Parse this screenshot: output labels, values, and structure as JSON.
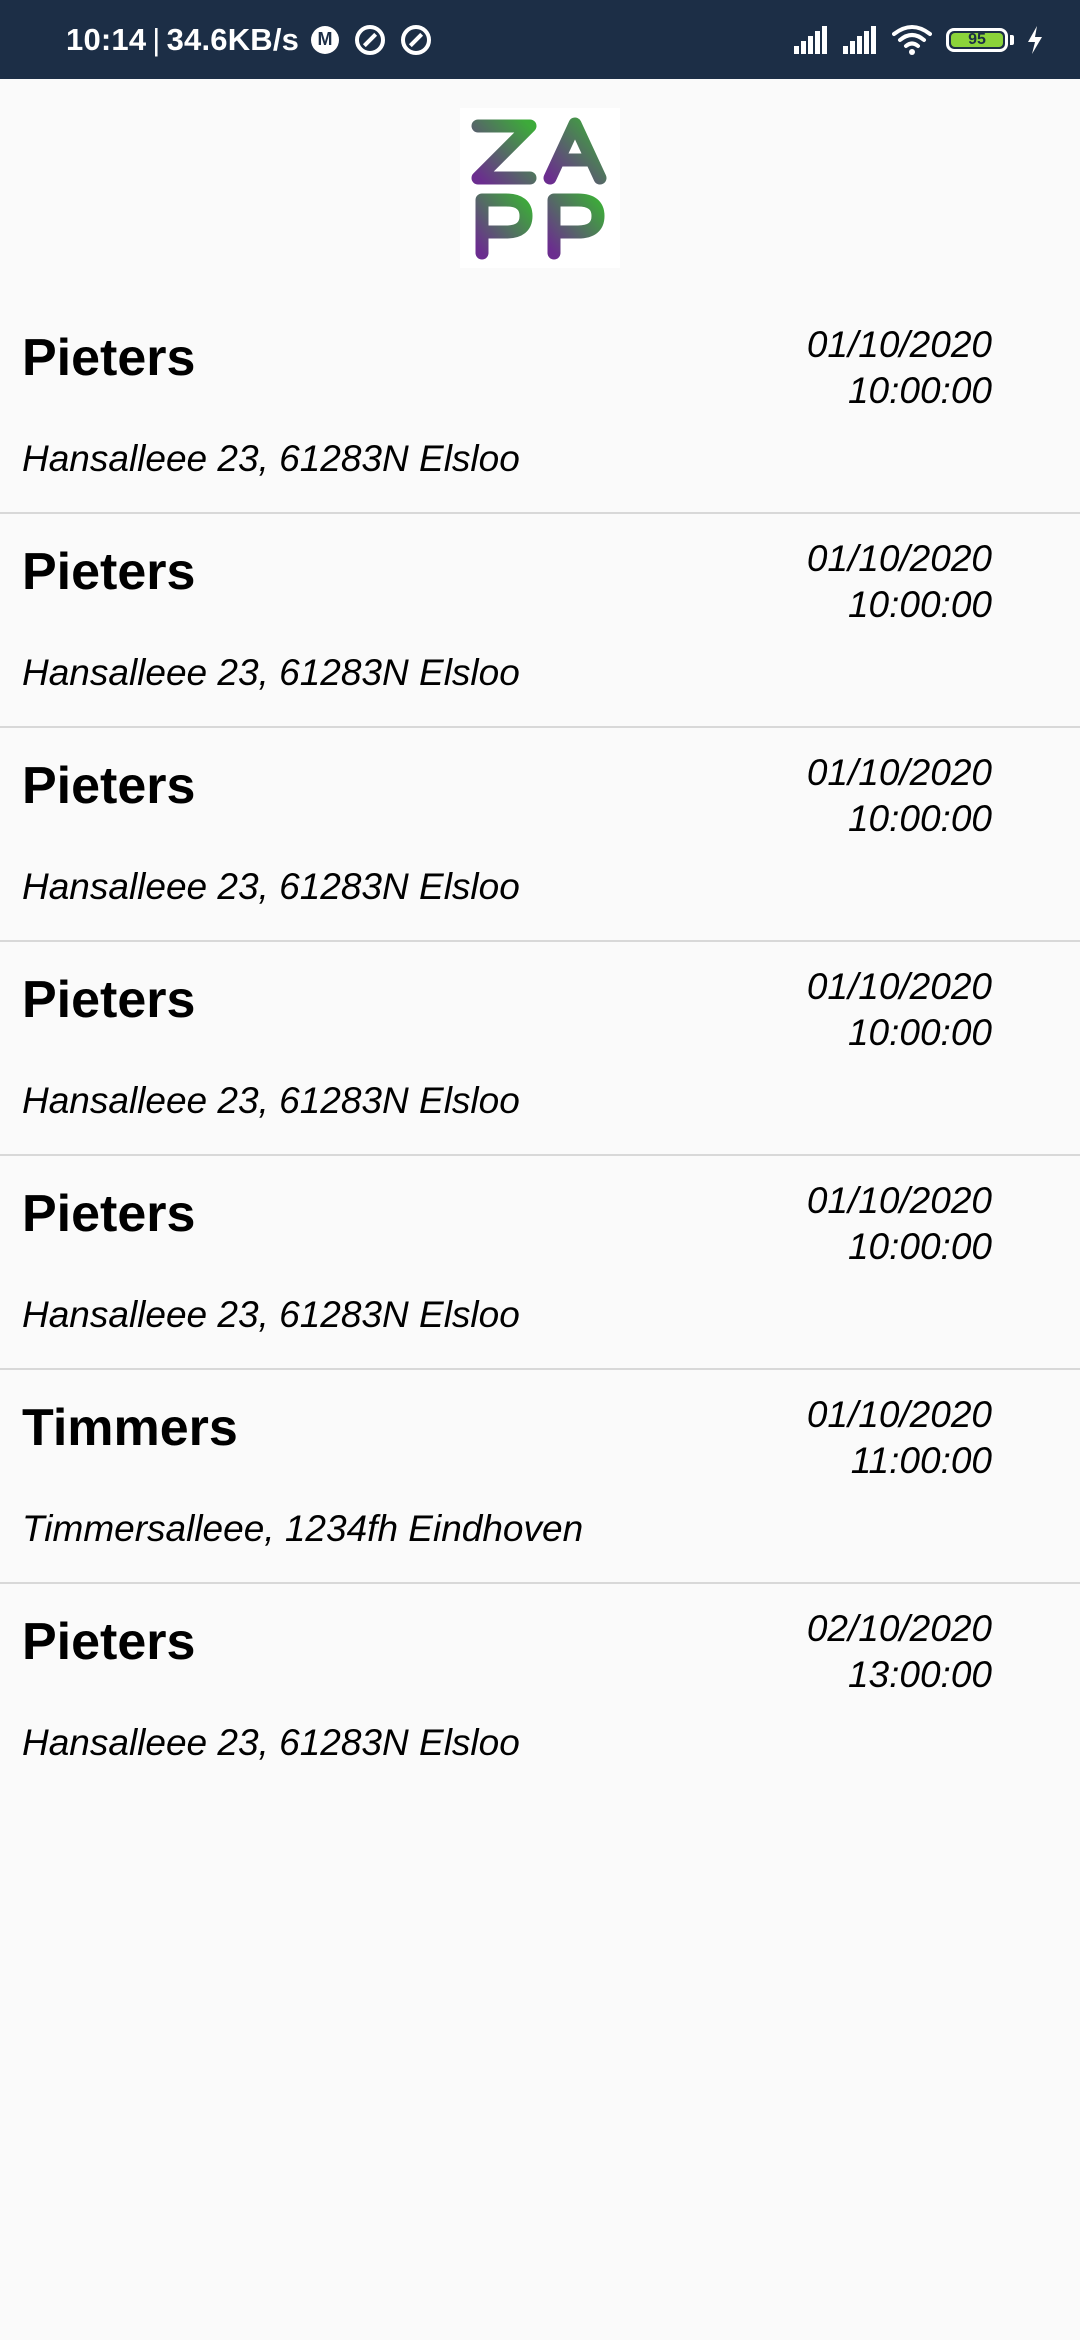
{
  "status_bar": {
    "time": "10:14",
    "separator": "|",
    "network_speed": "34.6KB/s",
    "badge_m": "M",
    "battery_level": "95",
    "icons": [
      "m-badge-icon",
      "vpn-ring-icon",
      "vpn-ring-icon",
      "signal-icon",
      "signal-icon",
      "wifi-icon",
      "battery-icon",
      "charging-bolt-icon"
    ]
  },
  "logo": {
    "letters": [
      "Z",
      "A",
      "P",
      "P"
    ],
    "colors": {
      "purple": "#6b2d8f",
      "green": "#3daa3a"
    }
  },
  "appointments": [
    {
      "name": "Pieters",
      "date": "01/10/2020",
      "time": "10:00:00",
      "address": "Hansalleee 23, 61283N Elsloo"
    },
    {
      "name": "Pieters",
      "date": "01/10/2020",
      "time": "10:00:00",
      "address": "Hansalleee 23, 61283N Elsloo"
    },
    {
      "name": "Pieters",
      "date": "01/10/2020",
      "time": "10:00:00",
      "address": "Hansalleee 23, 61283N Elsloo"
    },
    {
      "name": "Pieters",
      "date": "01/10/2020",
      "time": "10:00:00",
      "address": "Hansalleee 23, 61283N Elsloo"
    },
    {
      "name": "Pieters",
      "date": "01/10/2020",
      "time": "10:00:00",
      "address": "Hansalleee 23, 61283N Elsloo"
    },
    {
      "name": "Timmers",
      "date": "01/10/2020",
      "time": "11:00:00",
      "address": "Timmersalleee, 1234fh Eindhoven"
    },
    {
      "name": "Pieters",
      "date": "02/10/2020",
      "time": "13:00:00",
      "address": "Hansalleee 23, 61283N Elsloo"
    }
  ]
}
